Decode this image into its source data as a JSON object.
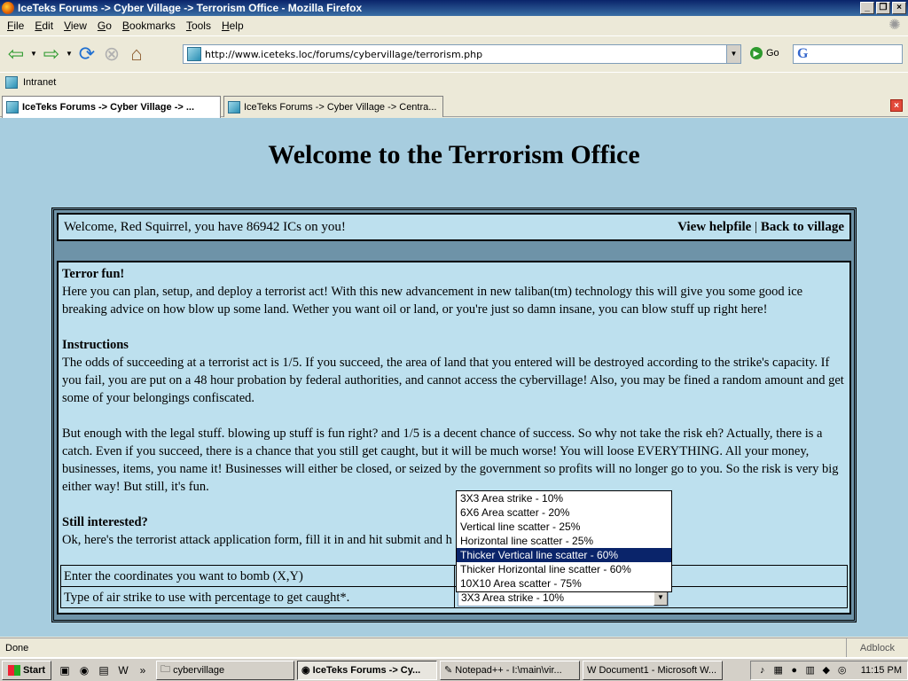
{
  "window": {
    "title": "IceTeks Forums -> Cyber Village -> Terrorism Office - Mozilla Firefox"
  },
  "menu": {
    "items": [
      {
        "u": "F",
        "rest": "ile"
      },
      {
        "u": "E",
        "rest": "dit"
      },
      {
        "u": "V",
        "rest": "iew"
      },
      {
        "u": "G",
        "rest": "o"
      },
      {
        "u": "B",
        "rest": "ookmarks"
      },
      {
        "u": "T",
        "rest": "ools"
      },
      {
        "u": "H",
        "rest": "elp"
      }
    ]
  },
  "nav": {
    "url": "http://www.iceteks.loc/forums/cybervillage/terrorism.php",
    "go_label": "Go"
  },
  "bookmarks": {
    "items": [
      "Intranet"
    ]
  },
  "tabs": [
    {
      "label": "IceTeks Forums -> Cyber Village -> ...",
      "active": true
    },
    {
      "label": "IceTeks Forums -> Cyber Village -> Centra...",
      "active": false
    }
  ],
  "page": {
    "title": "Welcome to the Terrorism Office",
    "welcome": "Welcome, Red Squirrel, you have 86942 ICs on you!",
    "link_help": "View helpfile",
    "link_separator": "|",
    "link_back": "Back to village",
    "section1_heading": "Terror fun!",
    "section1_text": "Here you can plan, setup, and deploy a terrorist act! With this new advancement in new taliban(tm) technology this will give you some good ice breaking advice on how blow up some land. Wether you want oil or land, or you're just so damn insane, you can blow stuff up right here!",
    "section2_heading": "Instructions",
    "section2_text": "The odds of succeeding at a terrorist act is 1/5. If you succeed, the area of land that you entered will be destroyed according to the strike's capacity. If you fail, you are put on a 48 hour probation by federal authorities, and cannot access the cybervillage! Also, you may be fined a random amount and get some of your belongings confiscated.",
    "section3_text": "But enough with the legal stuff. blowing up stuff is fun right? and 1/5 is a decent chance of success. So why not take the risk eh? Actually, there is a catch. Even if you succeed, there is a chance that you still get caught, but it will be much worse! You will loose EVERYTHING. All your money, businesses, items, you name it! Businesses will either be closed, or seized by the government so profits will no longer go to you. So the risk is very big either way! But still, it's fun.",
    "section4_heading": "Still interested?",
    "section4_text": "Ok, here's the terrorist attack application form, fill it in and hit submit and h",
    "form": {
      "coord_label": "Enter the coordinates you want to bomb (X,Y)",
      "strike_label": "Type of air strike to use with percentage to get caught*.",
      "strike_selected": "3X3 Area strike - 10%",
      "strike_options": [
        "3X3 Area strike - 10%",
        "6X6 Area scatter - 20%",
        "Vertical line scatter - 25%",
        "Horizontal line scatter - 25%",
        "Thicker Vertical line scatter - 60%",
        "Thicker Horizontal line scatter - 60%",
        "10X10 Area scatter - 75%"
      ],
      "highlighted_option": 4
    }
  },
  "status": {
    "text": "Done",
    "adblock": "Adblock"
  },
  "taskbar": {
    "start": "Start",
    "tasks": [
      {
        "label": "cybervillage",
        "active": false
      },
      {
        "label": "IceTeks Forums -> Cy...",
        "active": true
      },
      {
        "label": "Notepad++ - I:\\main\\vir...",
        "active": false
      },
      {
        "label": "Document1 - Microsoft W...",
        "active": false
      }
    ],
    "clock": "11:15 PM"
  },
  "colors": {
    "page_bg": "#A7CDDF",
    "panel_bg": "#BDE0EE",
    "highlight": "#0A246A"
  }
}
